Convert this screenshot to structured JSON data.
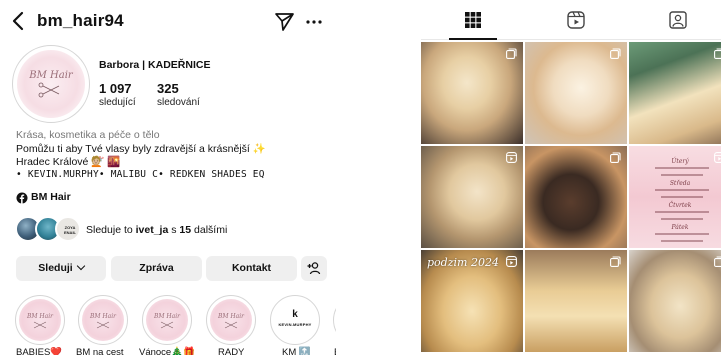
{
  "profile": {
    "username": "bm_hair94",
    "full_name": "Barbora | KADEŘNICE",
    "stats": [
      {
        "value": "1 097",
        "label": "sledující"
      },
      {
        "value": "325",
        "label": "sledování"
      }
    ],
    "category": "Krása, kosmetika a péče o tělo",
    "bio_lines": [
      "Pomůžu ti aby Tvé vlasy byly zdravější a krásnější ✨",
      "Hradec Králové 💇🏼 🌇",
      "• KEVIN.MURPHY• MALIBU C• REDKEN SHADES EQ"
    ],
    "facebook_link": "BM Hair",
    "avatar_text": "BM Hair",
    "followed_by": {
      "prefix": "Sleduje to ",
      "user": "ivet_ja",
      "middle": " s ",
      "count": "15",
      "suffix": " dalšími",
      "third_avatar_text": "ZOYA ENAIL"
    }
  },
  "actions": {
    "follow_label": "Sleduji",
    "message_label": "Zpráva",
    "contact_label": "Kontakt"
  },
  "highlights": [
    {
      "label": "BABIES❤️"
    },
    {
      "label": "BM na cest"
    },
    {
      "label": "Vánoce🎄🎁"
    },
    {
      "label": "RADY"
    },
    {
      "label": "KM 🔝",
      "logo_letter": "k",
      "logo_text": "KEVIN.MURPHY"
    },
    {
      "label": "E"
    }
  ],
  "tabs": [
    {
      "name": "grid",
      "icon": "grid-icon",
      "active": true
    },
    {
      "name": "reels",
      "icon": "reels-icon",
      "active": false
    },
    {
      "name": "tagged",
      "icon": "tagged-icon",
      "active": false
    }
  ],
  "grid_posts": [
    {
      "type": "carousel"
    },
    {
      "type": "carousel"
    },
    {
      "type": "carousel"
    },
    {
      "type": "reel"
    },
    {
      "type": "carousel"
    },
    {
      "type": "reel",
      "menu_headings": [
        "Úterý",
        "Středa",
        "Čtvrtek",
        "Pátek"
      ]
    },
    {
      "type": "reel",
      "overlay_text": "podzim 2024"
    },
    {
      "type": "carousel"
    },
    {
      "type": "carousel"
    }
  ],
  "colors": {
    "button_bg": "#efefef",
    "muted_text": "#777777",
    "highlight_ring": "#d6d6d6"
  }
}
